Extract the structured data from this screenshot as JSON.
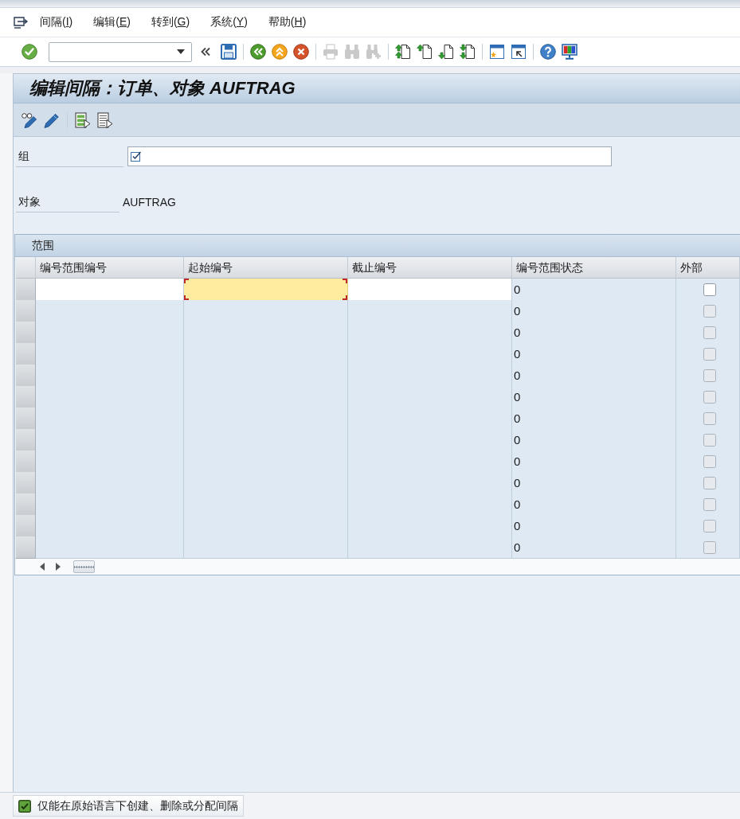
{
  "menu_bar": {
    "items": [
      {
        "text": "间隔(",
        "accel": "I",
        "close": ")"
      },
      {
        "text": "编辑(",
        "accel": "E",
        "close": ")"
      },
      {
        "text": "转到(",
        "accel": "G",
        "close": ")"
      },
      {
        "text": "系统(",
        "accel": "Y",
        "close": ")"
      },
      {
        "text": "帮助(",
        "accel": "H",
        "close": ")"
      }
    ]
  },
  "toolbar": {
    "groups": [
      {
        "items": [
          {
            "kind": "enter",
            "disabled": false
          },
          {
            "kind": "command_field",
            "disabled": false
          },
          {
            "kind": "collapse",
            "disabled": false
          },
          {
            "kind": "save",
            "disabled": false
          }
        ]
      },
      {
        "items": [
          {
            "kind": "back",
            "disabled": false
          },
          {
            "kind": "exit",
            "disabled": false
          },
          {
            "kind": "cancel",
            "disabled": false
          }
        ]
      },
      {
        "items": [
          {
            "kind": "print",
            "disabled": true
          },
          {
            "kind": "find",
            "disabled": true
          },
          {
            "kind": "find_next",
            "disabled": true
          }
        ]
      },
      {
        "items": [
          {
            "kind": "first_page",
            "disabled": false
          },
          {
            "kind": "previous_page",
            "disabled": false
          },
          {
            "kind": "next_page",
            "disabled": false
          },
          {
            "kind": "last_page",
            "disabled": false
          }
        ]
      },
      {
        "items": [
          {
            "kind": "new_session",
            "disabled": false
          },
          {
            "kind": "shortcut",
            "disabled": false
          }
        ]
      },
      {
        "items": [
          {
            "kind": "help",
            "disabled": false
          },
          {
            "kind": "layout",
            "disabled": false
          }
        ]
      }
    ]
  },
  "title_bar": {
    "title": "编辑间隔：订单、对象 AUFTRAG"
  },
  "application_toolbar": {
    "groups": [
      {
        "items": [
          {
            "kind": "display_change"
          },
          {
            "kind": "change"
          }
        ]
      },
      {
        "items": [
          {
            "kind": "select_block"
          },
          {
            "kind": "select_all"
          }
        ]
      }
    ]
  },
  "fields": [
    {
      "kind": "input",
      "label": "组"
    },
    {
      "kind": "display",
      "label": "对象",
      "value": "AUFTRAG"
    }
  ],
  "table": {
    "title": "范围",
    "columns": [
      {
        "label": "编号范围编号"
      },
      {
        "label": "起始编号"
      },
      {
        "label": "截止编号"
      },
      {
        "label": "编号范围状态"
      },
      {
        "label": "外部"
      }
    ],
    "rows": [
      {
        "selected": false,
        "cells": [
          {
            "kind": "input",
            "focused": false
          },
          {
            "kind": "input",
            "focused": true
          },
          {
            "kind": "input",
            "focused": false
          },
          {
            "kind": "text",
            "value": "0"
          },
          {
            "kind": "checkbox",
            "checked": false,
            "disabled": false
          }
        ]
      },
      {
        "selected": false,
        "cells": [
          {
            "kind": "empty"
          },
          {
            "kind": "empty"
          },
          {
            "kind": "empty"
          },
          {
            "kind": "text",
            "value": "0"
          },
          {
            "kind": "checkbox",
            "checked": false,
            "disabled": true
          }
        ]
      },
      {
        "selected": false,
        "cells": [
          {
            "kind": "empty"
          },
          {
            "kind": "empty"
          },
          {
            "kind": "empty"
          },
          {
            "kind": "text",
            "value": "0"
          },
          {
            "kind": "checkbox",
            "checked": false,
            "disabled": true
          }
        ]
      },
      {
        "selected": false,
        "cells": [
          {
            "kind": "empty"
          },
          {
            "kind": "empty"
          },
          {
            "kind": "empty"
          },
          {
            "kind": "text",
            "value": "0"
          },
          {
            "kind": "checkbox",
            "checked": false,
            "disabled": true
          }
        ]
      },
      {
        "selected": false,
        "cells": [
          {
            "kind": "empty"
          },
          {
            "kind": "empty"
          },
          {
            "kind": "empty"
          },
          {
            "kind": "text",
            "value": "0"
          },
          {
            "kind": "checkbox",
            "checked": false,
            "disabled": true
          }
        ]
      },
      {
        "selected": false,
        "cells": [
          {
            "kind": "empty"
          },
          {
            "kind": "empty"
          },
          {
            "kind": "empty"
          },
          {
            "kind": "text",
            "value": "0"
          },
          {
            "kind": "checkbox",
            "checked": false,
            "disabled": true
          }
        ]
      },
      {
        "selected": false,
        "cells": [
          {
            "kind": "empty"
          },
          {
            "kind": "empty"
          },
          {
            "kind": "empty"
          },
          {
            "kind": "text",
            "value": "0"
          },
          {
            "kind": "checkbox",
            "checked": false,
            "disabled": true
          }
        ]
      },
      {
        "selected": false,
        "cells": [
          {
            "kind": "empty"
          },
          {
            "kind": "empty"
          },
          {
            "kind": "empty"
          },
          {
            "kind": "text",
            "value": "0"
          },
          {
            "kind": "checkbox",
            "checked": false,
            "disabled": true
          }
        ]
      },
      {
        "selected": false,
        "cells": [
          {
            "kind": "empty"
          },
          {
            "kind": "empty"
          },
          {
            "kind": "empty"
          },
          {
            "kind": "text",
            "value": "0"
          },
          {
            "kind": "checkbox",
            "checked": false,
            "disabled": true
          }
        ]
      },
      {
        "selected": false,
        "cells": [
          {
            "kind": "empty"
          },
          {
            "kind": "empty"
          },
          {
            "kind": "empty"
          },
          {
            "kind": "text",
            "value": "0"
          },
          {
            "kind": "checkbox",
            "checked": false,
            "disabled": true
          }
        ]
      },
      {
        "selected": false,
        "cells": [
          {
            "kind": "empty"
          },
          {
            "kind": "empty"
          },
          {
            "kind": "empty"
          },
          {
            "kind": "text",
            "value": "0"
          },
          {
            "kind": "checkbox",
            "checked": false,
            "disabled": true
          }
        ]
      },
      {
        "selected": false,
        "cells": [
          {
            "kind": "empty"
          },
          {
            "kind": "empty"
          },
          {
            "kind": "empty"
          },
          {
            "kind": "text",
            "value": "0"
          },
          {
            "kind": "checkbox",
            "checked": false,
            "disabled": true
          }
        ]
      },
      {
        "selected": false,
        "cells": [
          {
            "kind": "empty"
          },
          {
            "kind": "empty"
          },
          {
            "kind": "empty"
          },
          {
            "kind": "text",
            "value": "0"
          },
          {
            "kind": "checkbox",
            "checked": false,
            "disabled": true
          }
        ]
      }
    ]
  },
  "status_bar": {
    "messages": [
      {
        "kind": "success",
        "text": "仅能在原始语言下创建、删除或分配间隔"
      }
    ]
  }
}
